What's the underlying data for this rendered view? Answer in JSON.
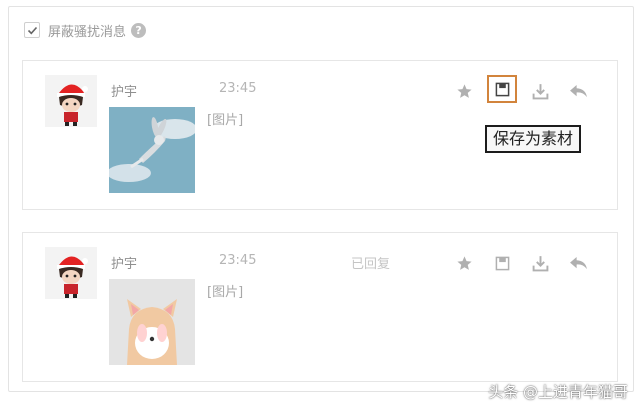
{
  "filter": {
    "label": "屏蔽骚扰消息",
    "checked": true,
    "help_glyph": "?"
  },
  "messages": [
    {
      "sender": "护宇",
      "time": "23:45",
      "status": "",
      "content": "[图片]",
      "image": "bugs-bunny-sticker",
      "actions": [
        "star-icon",
        "save-as-material-icon",
        "download-icon",
        "reply-icon"
      ],
      "highlight_action": "save-as-material-icon"
    },
    {
      "sender": "护宇",
      "time": "23:45",
      "status": "已回复",
      "content": "[图片]",
      "image": "shiba-dog-sticker",
      "actions": [
        "star-icon",
        "save-as-material-icon",
        "download-icon",
        "reply-icon"
      ]
    }
  ],
  "tooltip": {
    "text": "保存为素材"
  },
  "watermark": {
    "text": "头条 @上进青年猫哥"
  },
  "colors": {
    "highlight_border": "#d2843c",
    "icon_gray": "#b0b0b0"
  }
}
